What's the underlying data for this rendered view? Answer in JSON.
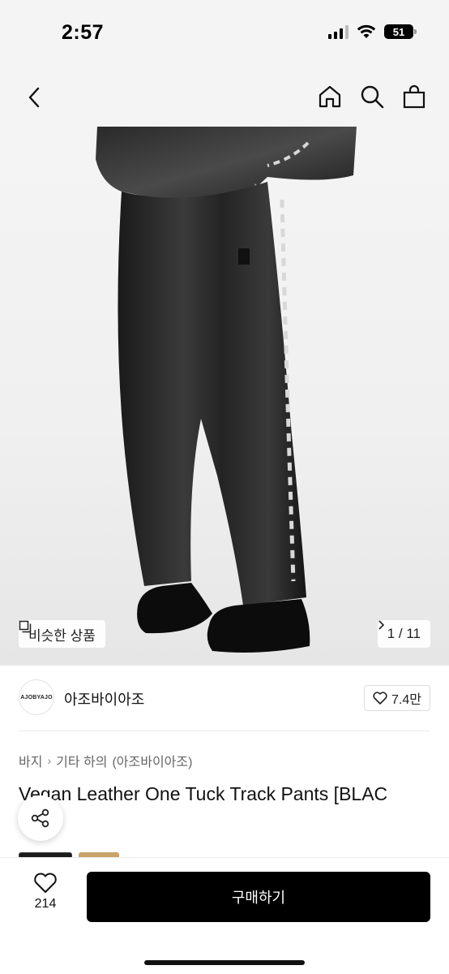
{
  "status_bar": {
    "time": "2:57",
    "battery_level": "51",
    "icons": [
      "signal-icon",
      "wifi-icon",
      "battery-icon"
    ]
  },
  "nav": {
    "back_icon": "chevron-left-icon",
    "home_icon": "home-icon",
    "search_icon": "search-icon",
    "cart_icon": "shopping-bag-icon"
  },
  "gallery": {
    "similar_label": "비슷한 상품",
    "current_page": "1",
    "total_pages": "11",
    "page_text": "1 / 11"
  },
  "shop": {
    "avatar_text": "AJOBYAJO",
    "name": "아조바이아조",
    "like_count": "7.4만"
  },
  "breadcrumb": {
    "level1": "바지",
    "level2": "기타 하의",
    "level2_suffix": "(아조바이아조)"
  },
  "product": {
    "title": "Vegan Leather One Tuck Track Pants [BLAC"
  },
  "bottom_bar": {
    "wish_count": "214",
    "buy_label": "구매하기"
  },
  "colors": {
    "accent": "#000000",
    "background": "#ffffff",
    "hero_bg": "#f4f4f4"
  }
}
